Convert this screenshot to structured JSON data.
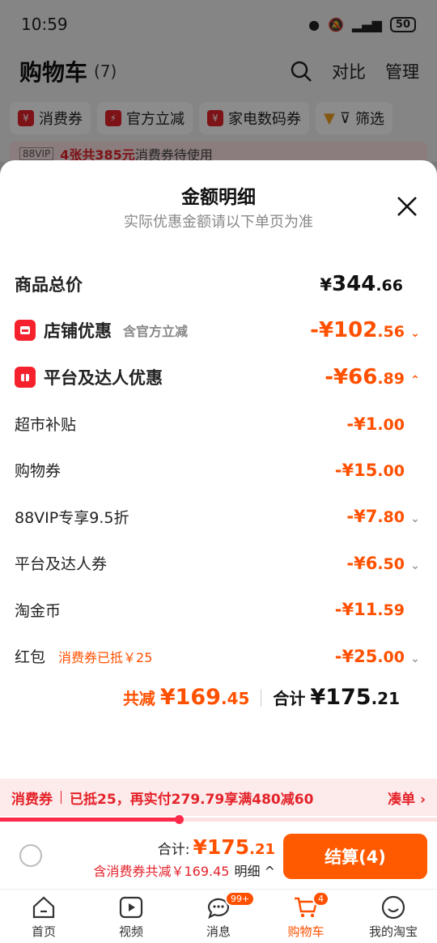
{
  "status": {
    "time": "10:59",
    "battery": "50"
  },
  "header": {
    "title": "购物车",
    "count": "(7)",
    "compare": "对比",
    "manage": "管理"
  },
  "chips": [
    {
      "label": "消费券"
    },
    {
      "label": "官方立减"
    },
    {
      "label": "家电数码券"
    },
    {
      "label": "筛选"
    }
  ],
  "promo": {
    "vip": "88VIP",
    "highlight": "4张共385元",
    "text": "消费券待使用"
  },
  "sheet": {
    "title": "金额明细",
    "subtitle": "实际优惠金额请以下单页为准",
    "total": {
      "label": "商品总价",
      "currency": "¥",
      "int": "344",
      "dec": ".66"
    },
    "store": {
      "label": "店铺优惠",
      "sub": "含官方立减",
      "value_int": "-¥102",
      "value_dec": ".56"
    },
    "platform": {
      "label": "平台及达人优惠",
      "value_int": "-¥66",
      "value_dec": ".89"
    },
    "items": [
      {
        "label": "超市补贴",
        "int": "-¥1",
        "dec": ".00",
        "note": "",
        "chev": false
      },
      {
        "label": "购物券",
        "int": "-¥15",
        "dec": ".00",
        "note": "",
        "chev": false
      },
      {
        "label": "88VIP专享9.5折",
        "int": "-¥7",
        "dec": ".80",
        "note": "",
        "chev": true
      },
      {
        "label": "平台及达人券",
        "int": "-¥6",
        "dec": ".50",
        "note": "",
        "chev": true
      },
      {
        "label": "淘金币",
        "int": "-¥11",
        "dec": ".59",
        "note": "",
        "chev": false
      },
      {
        "label": "红包",
        "int": "-¥25",
        "dec": ".00",
        "note": "消费券已抵￥25",
        "chev": true
      }
    ],
    "summary": {
      "reduce_label": "共减",
      "reduce_int": "¥169",
      "reduce_dec": ".45",
      "sum_label": "合计",
      "sum_int": "¥175",
      "sum_dec": ".21"
    }
  },
  "coupon_bar": {
    "tag": "消费券",
    "text": "已抵25，再实付279.79享满480减60",
    "link": "凑单 ›",
    "progress": 0.41
  },
  "checkout": {
    "total_label": "合计:",
    "total_int": "¥175",
    "total_dec": ".21",
    "sub": "含消费券共减￥169.45",
    "detail": "明细 ^",
    "button": "结算(4)"
  },
  "tabbar": [
    {
      "label": "首页",
      "icon": "home-icon",
      "badge": ""
    },
    {
      "label": "视频",
      "icon": "video-icon",
      "badge": ""
    },
    {
      "label": "消息",
      "icon": "message-icon",
      "badge": "99+"
    },
    {
      "label": "购物车",
      "icon": "cart-icon",
      "badge": "4"
    },
    {
      "label": "我的淘宝",
      "icon": "profile-icon",
      "badge": ""
    }
  ],
  "colors": {
    "accent": "#ff5000",
    "red": "#e4222a"
  }
}
